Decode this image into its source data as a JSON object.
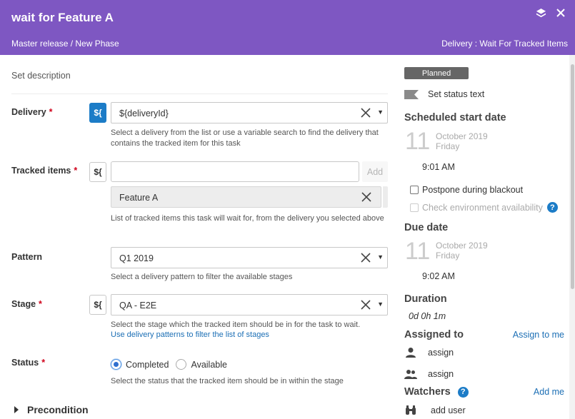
{
  "header": {
    "title": "wait for Feature A",
    "breadcrumb": "Master release / New Phase",
    "task_type": "Delivery : Wait For Tracked Items",
    "color": "#7e57c2"
  },
  "form": {
    "set_description": "Set description",
    "var_button_label": "${",
    "delivery": {
      "label": "Delivery",
      "required": "*",
      "value": "${deliveryId}",
      "help": "Select a delivery from the list or use a variable search to find the delivery that contains the tracked item for this task"
    },
    "tracked_items": {
      "label": "Tracked items",
      "required": "*",
      "input_value": "",
      "add_label": "Add",
      "items": [
        "Feature A"
      ],
      "help": "List of tracked items this task will wait for, from the delivery you selected above"
    },
    "pattern": {
      "label": "Pattern",
      "value": "Q1 2019",
      "help": "Select a delivery pattern to filter the available stages"
    },
    "stage": {
      "label": "Stage",
      "required": "*",
      "value": "QA - E2E",
      "help": "Select the stage which the tracked item should be in for the task to wait.",
      "link": "Use delivery patterns to filter the list of stages"
    },
    "status": {
      "label": "Status",
      "required": "*",
      "options": [
        "Completed",
        "Available"
      ],
      "selected": "Completed",
      "help": "Select the status that the tracked item should be in within the stage"
    },
    "precondition": "Precondition"
  },
  "sidebar": {
    "status_badge": "Planned",
    "set_status_text": "Set status text",
    "scheduled_start": {
      "heading": "Scheduled start date",
      "day": "11",
      "month_year": "October 2019",
      "weekday": "Friday",
      "time": "9:01 AM"
    },
    "postpone_blackout": "Postpone during blackout",
    "check_env": "Check environment availability",
    "due": {
      "heading": "Due date",
      "day": "11",
      "month_year": "October 2019",
      "weekday": "Friday",
      "time": "9:02 AM"
    },
    "duration": {
      "heading": "Duration",
      "value": "0d 0h 1m"
    },
    "assigned": {
      "heading": "Assigned to",
      "assign_to_me": "Assign to me",
      "user": "assign",
      "team": "assign"
    },
    "watchers": {
      "heading": "Watchers",
      "add_me": "Add me",
      "add_user": "add user"
    }
  }
}
